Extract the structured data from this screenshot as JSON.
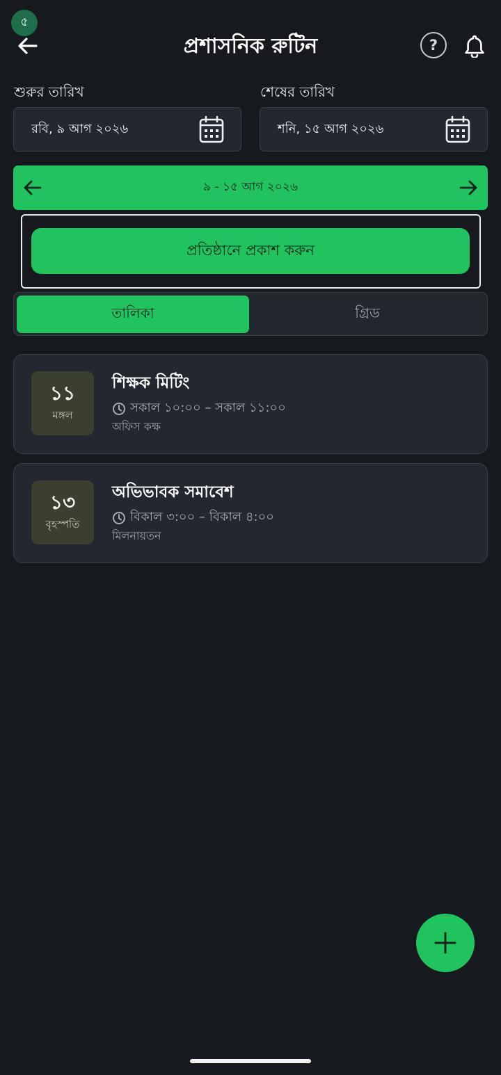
{
  "status": {
    "badge": "৫"
  },
  "header": {
    "title": "প্রশাসনিক রুটিন",
    "help_label": "?"
  },
  "date_range": {
    "start": {
      "label": "শুরুর তারিখ",
      "value": "রবি, ৯ আগ ২০২৬"
    },
    "end": {
      "label": "শেষের তারিখ",
      "value": "শনি, ১৫ আগ ২০২৬"
    }
  },
  "week_nav": {
    "label": "৯ - ১৫ আগ ২০২৬"
  },
  "publish": {
    "label": "প্রতিষ্ঠানে প্রকাশ করুন"
  },
  "view_toggle": {
    "tabs": [
      "তালিকা",
      "গ্রিড"
    ],
    "selected": "তালিকা"
  },
  "events": [
    {
      "day": "১১",
      "weekday": "মঙ্গল",
      "title": "শিক্ষক মিটিং",
      "time": "সকাল ১০:০০ – সকাল ১১:০০",
      "location": "অফিস কক্ষ"
    },
    {
      "day": "১৩",
      "weekday": "বৃহস্পতি",
      "title": "অভিভাবক সমাবেশ",
      "time": "বিকাল ৩:০০ – বিকাল ৪:০০",
      "location": "মিলনায়তন"
    }
  ],
  "icons": {
    "back": "arrow-left-icon",
    "help": "help-circle-icon",
    "bell": "bell-icon",
    "calendar": "calendar-icon",
    "prev": "arrow-left-icon",
    "next": "arrow-right-icon",
    "clock": "clock-icon",
    "add": "plus-icon"
  },
  "colors": {
    "background": "#16191e",
    "accent": "#21c35e",
    "surface": "#23272f",
    "chip": "#3b3f30",
    "status_badge": "#1f6e4a"
  }
}
